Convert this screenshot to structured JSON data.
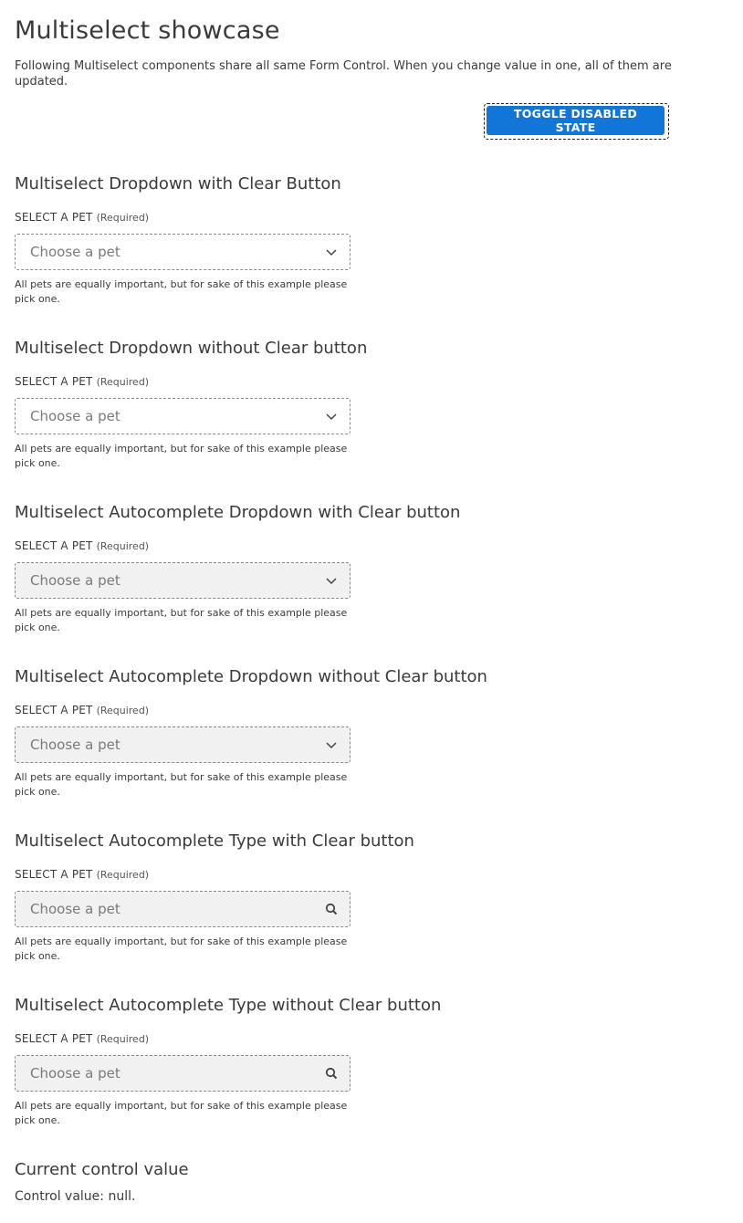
{
  "title": "Multiselect showcase",
  "intro": "Following Multiselect components share all same Form Control. When you change value in one, all of them are updated.",
  "toggle_label": "TOGGLE DISABLED STATE",
  "sections": [
    {
      "title": "Multiselect Dropdown with Clear Button",
      "label": "SELECT A PET",
      "required": "(Required)",
      "placeholder": "Choose a pet",
      "helper": "All pets are equally important, but for sake of this example please pick one.",
      "icon": "chevron-down-icon",
      "disabled": false
    },
    {
      "title": "Multiselect Dropdown without Clear button",
      "label": "SELECT A PET",
      "required": "(Required)",
      "placeholder": "Choose a pet",
      "helper": "All pets are equally important, but for sake of this example please pick one.",
      "icon": "chevron-down-icon",
      "disabled": false
    },
    {
      "title": "Multiselect Autocomplete Dropdown with Clear button",
      "label": "SELECT A PET",
      "required": "(Required)",
      "placeholder": "Choose a pet",
      "helper": "All pets are equally important, but for sake of this example please pick one.",
      "icon": "chevron-down-icon",
      "disabled": true
    },
    {
      "title": "Multiselect Autocomplete Dropdown without Clear button",
      "label": "SELECT A PET",
      "required": "(Required)",
      "placeholder": "Choose a pet",
      "helper": "All pets are equally important, but for sake of this example please pick one.",
      "icon": "chevron-down-icon",
      "disabled": true
    },
    {
      "title": "Multiselect Autocomplete Type with Clear button",
      "label": "SELECT A PET",
      "required": "(Required)",
      "placeholder": "Choose a pet",
      "helper": "All pets are equally important, but for sake of this example please pick one.",
      "icon": "search-icon",
      "disabled": true
    },
    {
      "title": "Multiselect Autocomplete Type without Clear button",
      "label": "SELECT A PET",
      "required": "(Required)",
      "placeholder": "Choose a pet",
      "helper": "All pets are equally important, but for sake of this example please pick one.",
      "icon": "search-icon",
      "disabled": true
    }
  ],
  "current_value": {
    "title": "Current control value",
    "text": "Control value: null."
  },
  "colors": {
    "button_bg": "#1275d8",
    "disabled_bg": "#f1f1f1",
    "text": "#3a3a3a"
  }
}
